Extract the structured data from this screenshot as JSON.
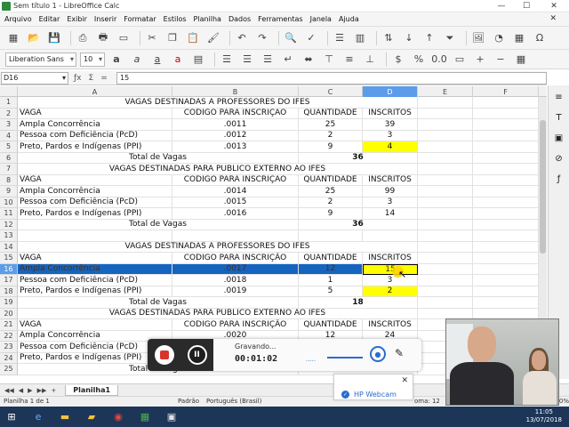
{
  "window": {
    "title": "Sem título 1 - LibreOffice Calc",
    "min": "—",
    "max": "☐",
    "close": "✕"
  },
  "menu": [
    "Arquivo",
    "Editar",
    "Exibir",
    "Inserir",
    "Formatar",
    "Estilos",
    "Planilha",
    "Dados",
    "Ferramentas",
    "Janela",
    "Ajuda"
  ],
  "menu_close": "✕",
  "format": {
    "font_name": "Liberation Sans",
    "font_size": "10"
  },
  "formula": {
    "cell_ref": "D16",
    "content": "15"
  },
  "columns": [
    "A",
    "B",
    "C",
    "D",
    "E",
    "F"
  ],
  "rows": [
    {
      "n": "1",
      "type": "section",
      "text": "VAGAS DESTINADAS A PROFESSORES DO IFES"
    },
    {
      "n": "2",
      "type": "header",
      "a": "VAGA",
      "b": "CODIGO PARA INSCRIÇÃO",
      "c": "QUANTIDADE",
      "d": "INSCRITOS"
    },
    {
      "n": "3",
      "type": "data",
      "a": "Ampla Concorrência",
      "b": ".0011",
      "c": "25",
      "d": "39"
    },
    {
      "n": "4",
      "type": "data",
      "a": "Pessoa com Deficiência (PcD)",
      "b": ".0012",
      "c": "2",
      "d": "3"
    },
    {
      "n": "5",
      "type": "data",
      "a": "Preto, Pardos e Indígenas (PPI)",
      "b": ".0013",
      "c": "9",
      "d": "4",
      "yellow": true
    },
    {
      "n": "6",
      "type": "total",
      "label": "Total de Vagas",
      "c": "36"
    },
    {
      "n": "7",
      "type": "section",
      "text": "VAGAS DESTINADAS PARA PUBLICO EXTERNO AO IFES"
    },
    {
      "n": "8",
      "type": "header",
      "a": "VAGA",
      "b": "CODIGO PARA INSCRIÇÃO",
      "c": "QUANTIDADE",
      "d": "INSCRITOS"
    },
    {
      "n": "9",
      "type": "data",
      "a": "Ampla Concorrência",
      "b": ".0014",
      "c": "25",
      "d": "99"
    },
    {
      "n": "10",
      "type": "data",
      "a": "Pessoa com Deficiência (PcD)",
      "b": ".0015",
      "c": "2",
      "d": "3"
    },
    {
      "n": "11",
      "type": "data",
      "a": "Preto, Pardos e Indígenas (PPI)",
      "b": ".0016",
      "c": "9",
      "d": "14"
    },
    {
      "n": "12",
      "type": "total",
      "label": "Total de Vagas",
      "c": "36"
    },
    {
      "n": "13",
      "type": "empty"
    },
    {
      "n": "14",
      "type": "section",
      "text": "VAGAS DESTINADAS A PROFESSORES DO IFES"
    },
    {
      "n": "15",
      "type": "header",
      "a": "VAGA",
      "b": "CODIGO PARA INSCRIÇÃO",
      "c": "QUANTIDADE",
      "d": "INSCRITOS"
    },
    {
      "n": "16",
      "type": "data",
      "a": "Ampla Concorrência",
      "b": ".0017",
      "c": "12",
      "d": "15",
      "selected": true
    },
    {
      "n": "17",
      "type": "data",
      "a": "Pessoa com Deficiência (PcD)",
      "b": ".0018",
      "c": "1",
      "d": "3"
    },
    {
      "n": "18",
      "type": "data",
      "a": "Preto, Pardos e Indígenas (PPI)",
      "b": ".0019",
      "c": "5",
      "d": "2",
      "yellow": true
    },
    {
      "n": "19",
      "type": "total",
      "label": "Total de Vagas",
      "c": "18"
    },
    {
      "n": "20",
      "type": "section",
      "text": "VAGAS DESTINADAS PARA PUBLICO EXTERNO AO IFES"
    },
    {
      "n": "21",
      "type": "header",
      "a": "VAGA",
      "b": "CODIGO PARA INSCRIÇÃO",
      "c": "QUANTIDADE",
      "d": "INSCRITOS"
    },
    {
      "n": "22",
      "type": "data",
      "a": "Ampla Concorrência",
      "b": ".0020",
      "c": "12",
      "d": "24"
    },
    {
      "n": "23",
      "type": "data",
      "a": "Pessoa com Deficiência (PcD)",
      "b": "",
      "c": "",
      "d": ""
    },
    {
      "n": "24",
      "type": "data",
      "a": "Preto, Pardos e Indígenas (PPI)",
      "b": "",
      "c": "",
      "d": ""
    },
    {
      "n": "25",
      "type": "total",
      "label": "Total de Vagas",
      "c": "18"
    }
  ],
  "sheet_tab": "Planilha1",
  "status": {
    "sheet": "Planilha 1 de 1",
    "style": "Padrão",
    "lang": "Português (Brasil)",
    "sum": "oma: 12",
    "zoom": "120%"
  },
  "recorder": {
    "label": "Gravando...",
    "time": "00:01:02",
    "level": "....."
  },
  "webcam_label": "HP Webcam",
  "clock": {
    "time": "11:05",
    "date": "13/07/2018"
  },
  "colors": {
    "selection": "#1564c0",
    "highlight": "#ffff00"
  }
}
